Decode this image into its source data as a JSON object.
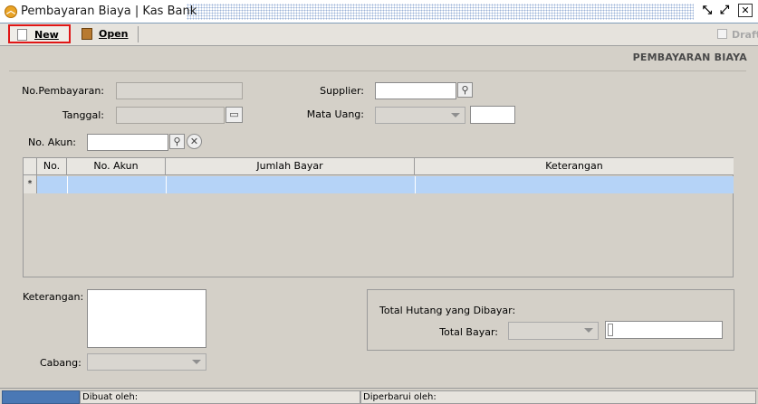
{
  "window": {
    "title": "Pembayaran Biaya | Kas Bank",
    "icon": "chevron-up-circle-icon",
    "controls": [
      "restore-icon",
      "maximize-icon",
      "close-icon"
    ]
  },
  "toolbar": {
    "new_label": "New",
    "open_label": "Open",
    "draft_label": "Draft"
  },
  "form": {
    "heading": "PEMBAYARAN BIAYA",
    "no_pembayaran_label": "No.Pembayaran:",
    "no_pembayaran_value": "",
    "tanggal_label": "Tanggal:",
    "tanggal_value": "",
    "supplier_label": "Supplier:",
    "supplier_value": "",
    "mata_uang_label": "Mata Uang:",
    "mata_uang_value": "",
    "kurs_value": "",
    "no_akun_label": "No. Akun:",
    "no_akun_value": ""
  },
  "grid": {
    "columns": [
      "No.",
      "No. Akun",
      "Jumlah Bayar",
      "Keterangan"
    ],
    "new_row_marker": "*",
    "rows": []
  },
  "footer_form": {
    "keterangan_label": "Keterangan:",
    "keterangan_value": "",
    "cabang_label": "Cabang:",
    "cabang_value": "",
    "total_hutang_label": "Total Hutang yang Dibayar:",
    "total_bayar_label": "Total Bayar:",
    "total_bayar_currency": "",
    "total_bayar_value": ""
  },
  "status": {
    "dibuat_label": "Dibuat oleh:",
    "diperbarui_label": "Diperbarui oleh:",
    "accent": "#4a78b5"
  }
}
